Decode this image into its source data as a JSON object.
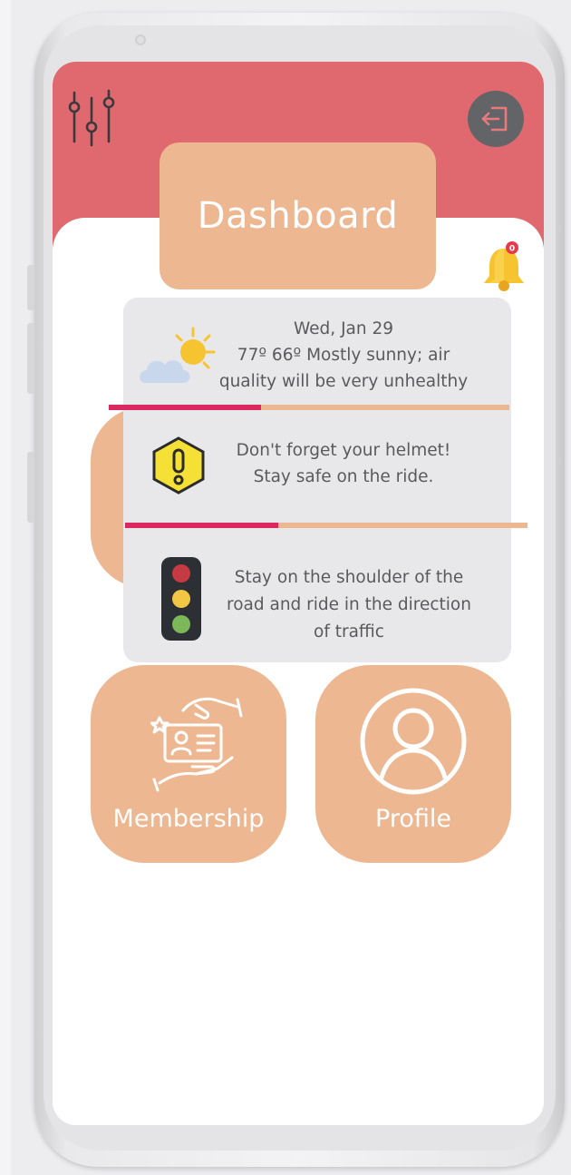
{
  "header": {
    "title": "Dashboard",
    "band_color": "#e0696f",
    "settings_icon": "sliders-icon",
    "logout_icon": "logout-icon",
    "notification_icon": "bell-icon",
    "notification_badge": "0"
  },
  "weather": {
    "icon": "partly-sunny-icon",
    "date": "Wed, Jan 29",
    "line2": "77º 66º Mostly sunny; air",
    "line3": "quality will be very unhealthy",
    "progress": 0.38
  },
  "helmet_tip": {
    "icon": "warning-icon",
    "line1": "Don't forget your helmet!",
    "line2": "Stay safe on the ride.",
    "progress": 0.38
  },
  "traffic_tip": {
    "icon": "traffic-light-icon",
    "line1": "Stay on the shoulder of the",
    "line2": "road and ride in the direction",
    "line3": "of traffic"
  },
  "tiles": {
    "membership": {
      "label": "Membership",
      "icon": "membership-card-icon"
    },
    "profile": {
      "label": "Profile",
      "icon": "user-profile-icon"
    }
  },
  "colors": {
    "accent": "#ecb791",
    "progress_fill": "#d9295f",
    "panel": "#e8e8ea"
  }
}
